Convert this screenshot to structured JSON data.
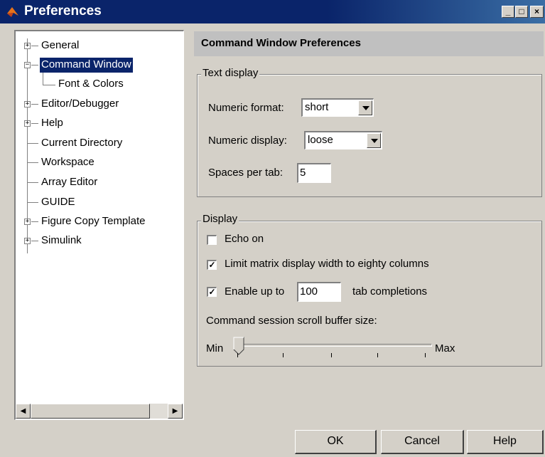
{
  "window": {
    "title": "Preferences",
    "minimize_glyph": "_",
    "maximize_glyph": "□",
    "close_glyph": "×"
  },
  "tree": {
    "expand_glyph": "+",
    "collapse_glyph": "−",
    "items": [
      {
        "label": "General",
        "expander": "+"
      },
      {
        "label": "Command Window",
        "expander": "−",
        "selected": true
      },
      {
        "label": "Font & Colors"
      },
      {
        "label": "Editor/Debugger",
        "expander": "+"
      },
      {
        "label": "Help",
        "expander": "+"
      },
      {
        "label": "Current Directory"
      },
      {
        "label": "Workspace"
      },
      {
        "label": "Array Editor"
      },
      {
        "label": "GUIDE"
      },
      {
        "label": "Figure Copy Template",
        "expander": "+"
      },
      {
        "label": "Simulink",
        "expander": "+"
      }
    ],
    "scroll_left_glyph": "◀",
    "scroll_right_glyph": "▶"
  },
  "panel": {
    "header": "Command Window Preferences",
    "text_display": {
      "title": "Text display",
      "numeric_format_label": "Numeric format:",
      "numeric_format_value": "short",
      "numeric_display_label": "Numeric display:",
      "numeric_display_value": "loose",
      "spaces_per_tab_label": "Spaces per tab:",
      "spaces_per_tab_value": "5"
    },
    "display": {
      "title": "Display",
      "echo_on_label": "Echo on",
      "echo_on_checked": false,
      "limit_width_label": "Limit matrix display width to eighty columns",
      "limit_width_checked": true,
      "enable_label_prefix": "Enable up to",
      "enable_value": "100",
      "enable_label_suffix": "tab completions",
      "enable_checked": true,
      "scroll_buffer_label": "Command session scroll buffer size:",
      "slider_min_label": "Min",
      "slider_max_label": "Max",
      "slider_position_fraction": 0.0,
      "check_glyph": "✓"
    }
  },
  "buttons": {
    "ok": "OK",
    "cancel": "Cancel",
    "help": "Help"
  },
  "colors": {
    "title_bar": "#0a246a",
    "selection": "#0a246a",
    "face": "#d4d0c8"
  }
}
